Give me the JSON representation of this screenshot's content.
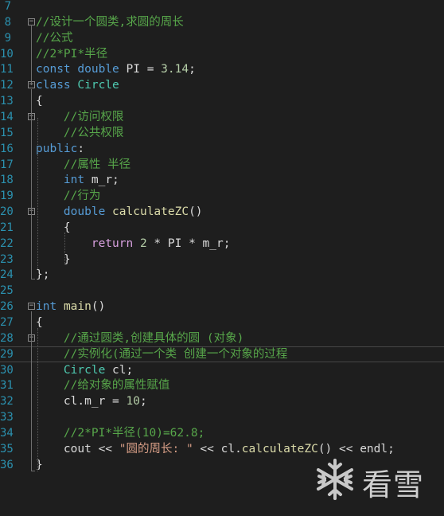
{
  "editor": {
    "lines": [
      {
        "n": "7",
        "parts": []
      },
      {
        "n": "8",
        "fold": "minus",
        "parts": [
          {
            "t": "//设计一个圆类,求圆的周长",
            "c": "cm"
          }
        ]
      },
      {
        "n": "9",
        "parts": [
          {
            "t": "//公式",
            "c": "cm"
          }
        ]
      },
      {
        "n": "10",
        "parts": [
          {
            "t": "//2*PI*半径",
            "c": "cm"
          }
        ]
      },
      {
        "n": "11",
        "parts": [
          {
            "t": "const",
            "c": "kw"
          },
          {
            "t": " ",
            "c": ""
          },
          {
            "t": "double",
            "c": "kw"
          },
          {
            "t": " PI = ",
            "c": "id"
          },
          {
            "t": "3.14",
            "c": "num"
          },
          {
            "t": ";",
            "c": "id"
          }
        ]
      },
      {
        "n": "12",
        "fold": "minus",
        "parts": [
          {
            "t": "class",
            "c": "kw"
          },
          {
            "t": " ",
            "c": ""
          },
          {
            "t": "Circle",
            "c": "ty"
          }
        ]
      },
      {
        "n": "13",
        "parts": [
          {
            "t": "{",
            "c": "id"
          }
        ]
      },
      {
        "n": "14",
        "fold": "minus",
        "parts": [
          {
            "t": "    //访问权限",
            "c": "cm"
          }
        ]
      },
      {
        "n": "15",
        "parts": [
          {
            "t": "    //公共权限",
            "c": "cm"
          }
        ]
      },
      {
        "n": "16",
        "parts": [
          {
            "t": "public",
            "c": "kw"
          },
          {
            "t": ":",
            "c": "id"
          }
        ]
      },
      {
        "n": "17",
        "parts": [
          {
            "t": "    //属性 半径",
            "c": "cm"
          }
        ]
      },
      {
        "n": "18",
        "parts": [
          {
            "t": "    ",
            "c": ""
          },
          {
            "t": "int",
            "c": "kw"
          },
          {
            "t": " m_r;",
            "c": "id"
          }
        ]
      },
      {
        "n": "19",
        "parts": [
          {
            "t": "    //行为",
            "c": "cm"
          }
        ]
      },
      {
        "n": "20",
        "fold": "minus",
        "parts": [
          {
            "t": "    ",
            "c": ""
          },
          {
            "t": "double",
            "c": "kw"
          },
          {
            "t": " ",
            "c": ""
          },
          {
            "t": "calculateZC",
            "c": "fn"
          },
          {
            "t": "()",
            "c": "id"
          }
        ]
      },
      {
        "n": "21",
        "parts": [
          {
            "t": "    {",
            "c": "id"
          }
        ]
      },
      {
        "n": "22",
        "parts": [
          {
            "t": "        ",
            "c": ""
          },
          {
            "t": "return",
            "c": "ctl"
          },
          {
            "t": " ",
            "c": ""
          },
          {
            "t": "2",
            "c": "num"
          },
          {
            "t": " * PI * m_r;",
            "c": "id"
          }
        ]
      },
      {
        "n": "23",
        "parts": [
          {
            "t": "    }",
            "c": "id"
          }
        ]
      },
      {
        "n": "24",
        "parts": [
          {
            "t": "};",
            "c": "id"
          }
        ]
      },
      {
        "n": "25",
        "parts": []
      },
      {
        "n": "26",
        "fold": "minus",
        "parts": [
          {
            "t": "int",
            "c": "kw"
          },
          {
            "t": " ",
            "c": ""
          },
          {
            "t": "main",
            "c": "fn"
          },
          {
            "t": "()",
            "c": "id"
          }
        ]
      },
      {
        "n": "27",
        "parts": [
          {
            "t": "{",
            "c": "id"
          }
        ]
      },
      {
        "n": "28",
        "fold": "minus",
        "parts": [
          {
            "t": "    //通过圆类,创建具体的圆 (对象)",
            "c": "cm"
          }
        ]
      },
      {
        "n": "29",
        "current": true,
        "parts": [
          {
            "t": "    //实例化(通过一个类 创建一个对象的过程",
            "c": "cm"
          }
        ]
      },
      {
        "n": "30",
        "parts": [
          {
            "t": "    ",
            "c": ""
          },
          {
            "t": "Circle",
            "c": "ty"
          },
          {
            "t": " cl;",
            "c": "id"
          }
        ]
      },
      {
        "n": "31",
        "parts": [
          {
            "t": "    //给对象的属性赋值",
            "c": "cm"
          }
        ]
      },
      {
        "n": "32",
        "parts": [
          {
            "t": "    cl.m_r = ",
            "c": "id"
          },
          {
            "t": "10",
            "c": "num"
          },
          {
            "t": ";",
            "c": "id"
          }
        ]
      },
      {
        "n": "33",
        "parts": []
      },
      {
        "n": "34",
        "parts": [
          {
            "t": "    //2*PI*半径(10)=62.8;",
            "c": "cm"
          }
        ]
      },
      {
        "n": "35",
        "parts": [
          {
            "t": "    cout << ",
            "c": "id"
          },
          {
            "t": "\"圆的周长: \"",
            "c": "str"
          },
          {
            "t": " << cl.",
            "c": "id"
          },
          {
            "t": "calculateZC",
            "c": "fn"
          },
          {
            "t": "() << endl;",
            "c": "id"
          }
        ]
      },
      {
        "n": "36",
        "parts": [
          {
            "t": "}",
            "c": "id"
          }
        ]
      }
    ]
  },
  "watermark": {
    "icon": "snowflake-icon",
    "text": "看雪"
  },
  "colors": {
    "background": "#1e1e1e",
    "keyword": "#569cd6",
    "type": "#4ec9b0",
    "comment": "#57a64a",
    "function": "#dcdcaa",
    "number": "#b5cea8",
    "string": "#d69d85",
    "control": "#d8a0df",
    "line_number": "#2b91af"
  }
}
